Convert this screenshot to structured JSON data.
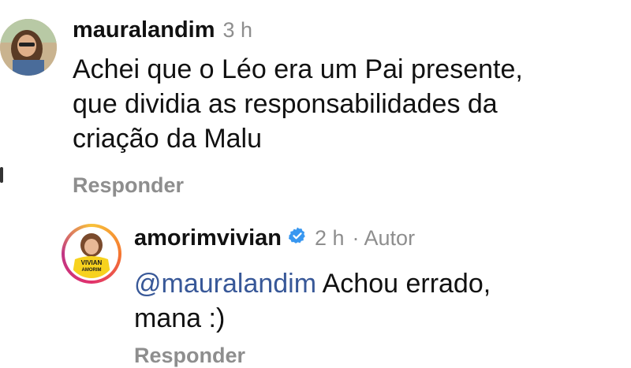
{
  "comments": [
    {
      "username": "mauralandim",
      "time": "3 h",
      "lines": [
        "Achei que o Léo era um Pai presente,",
        "que dividia as responsabilidades da",
        "criação da Malu"
      ],
      "reply_label": "Responder"
    },
    {
      "username": "amorimvivian",
      "time": "2 h",
      "author_tag": "· Autor",
      "mention": "@mauralandim",
      "text_rest": " Achou errado,",
      "text_line2": "mana :)",
      "reply_label": "Responder",
      "avatar_label": "VIVIAN AMORIM"
    }
  ],
  "colors": {
    "muted": "#8e8e8e",
    "mention": "#385898",
    "verified": "#3897f0"
  },
  "icons": {
    "verified": "verified-badge-icon"
  }
}
